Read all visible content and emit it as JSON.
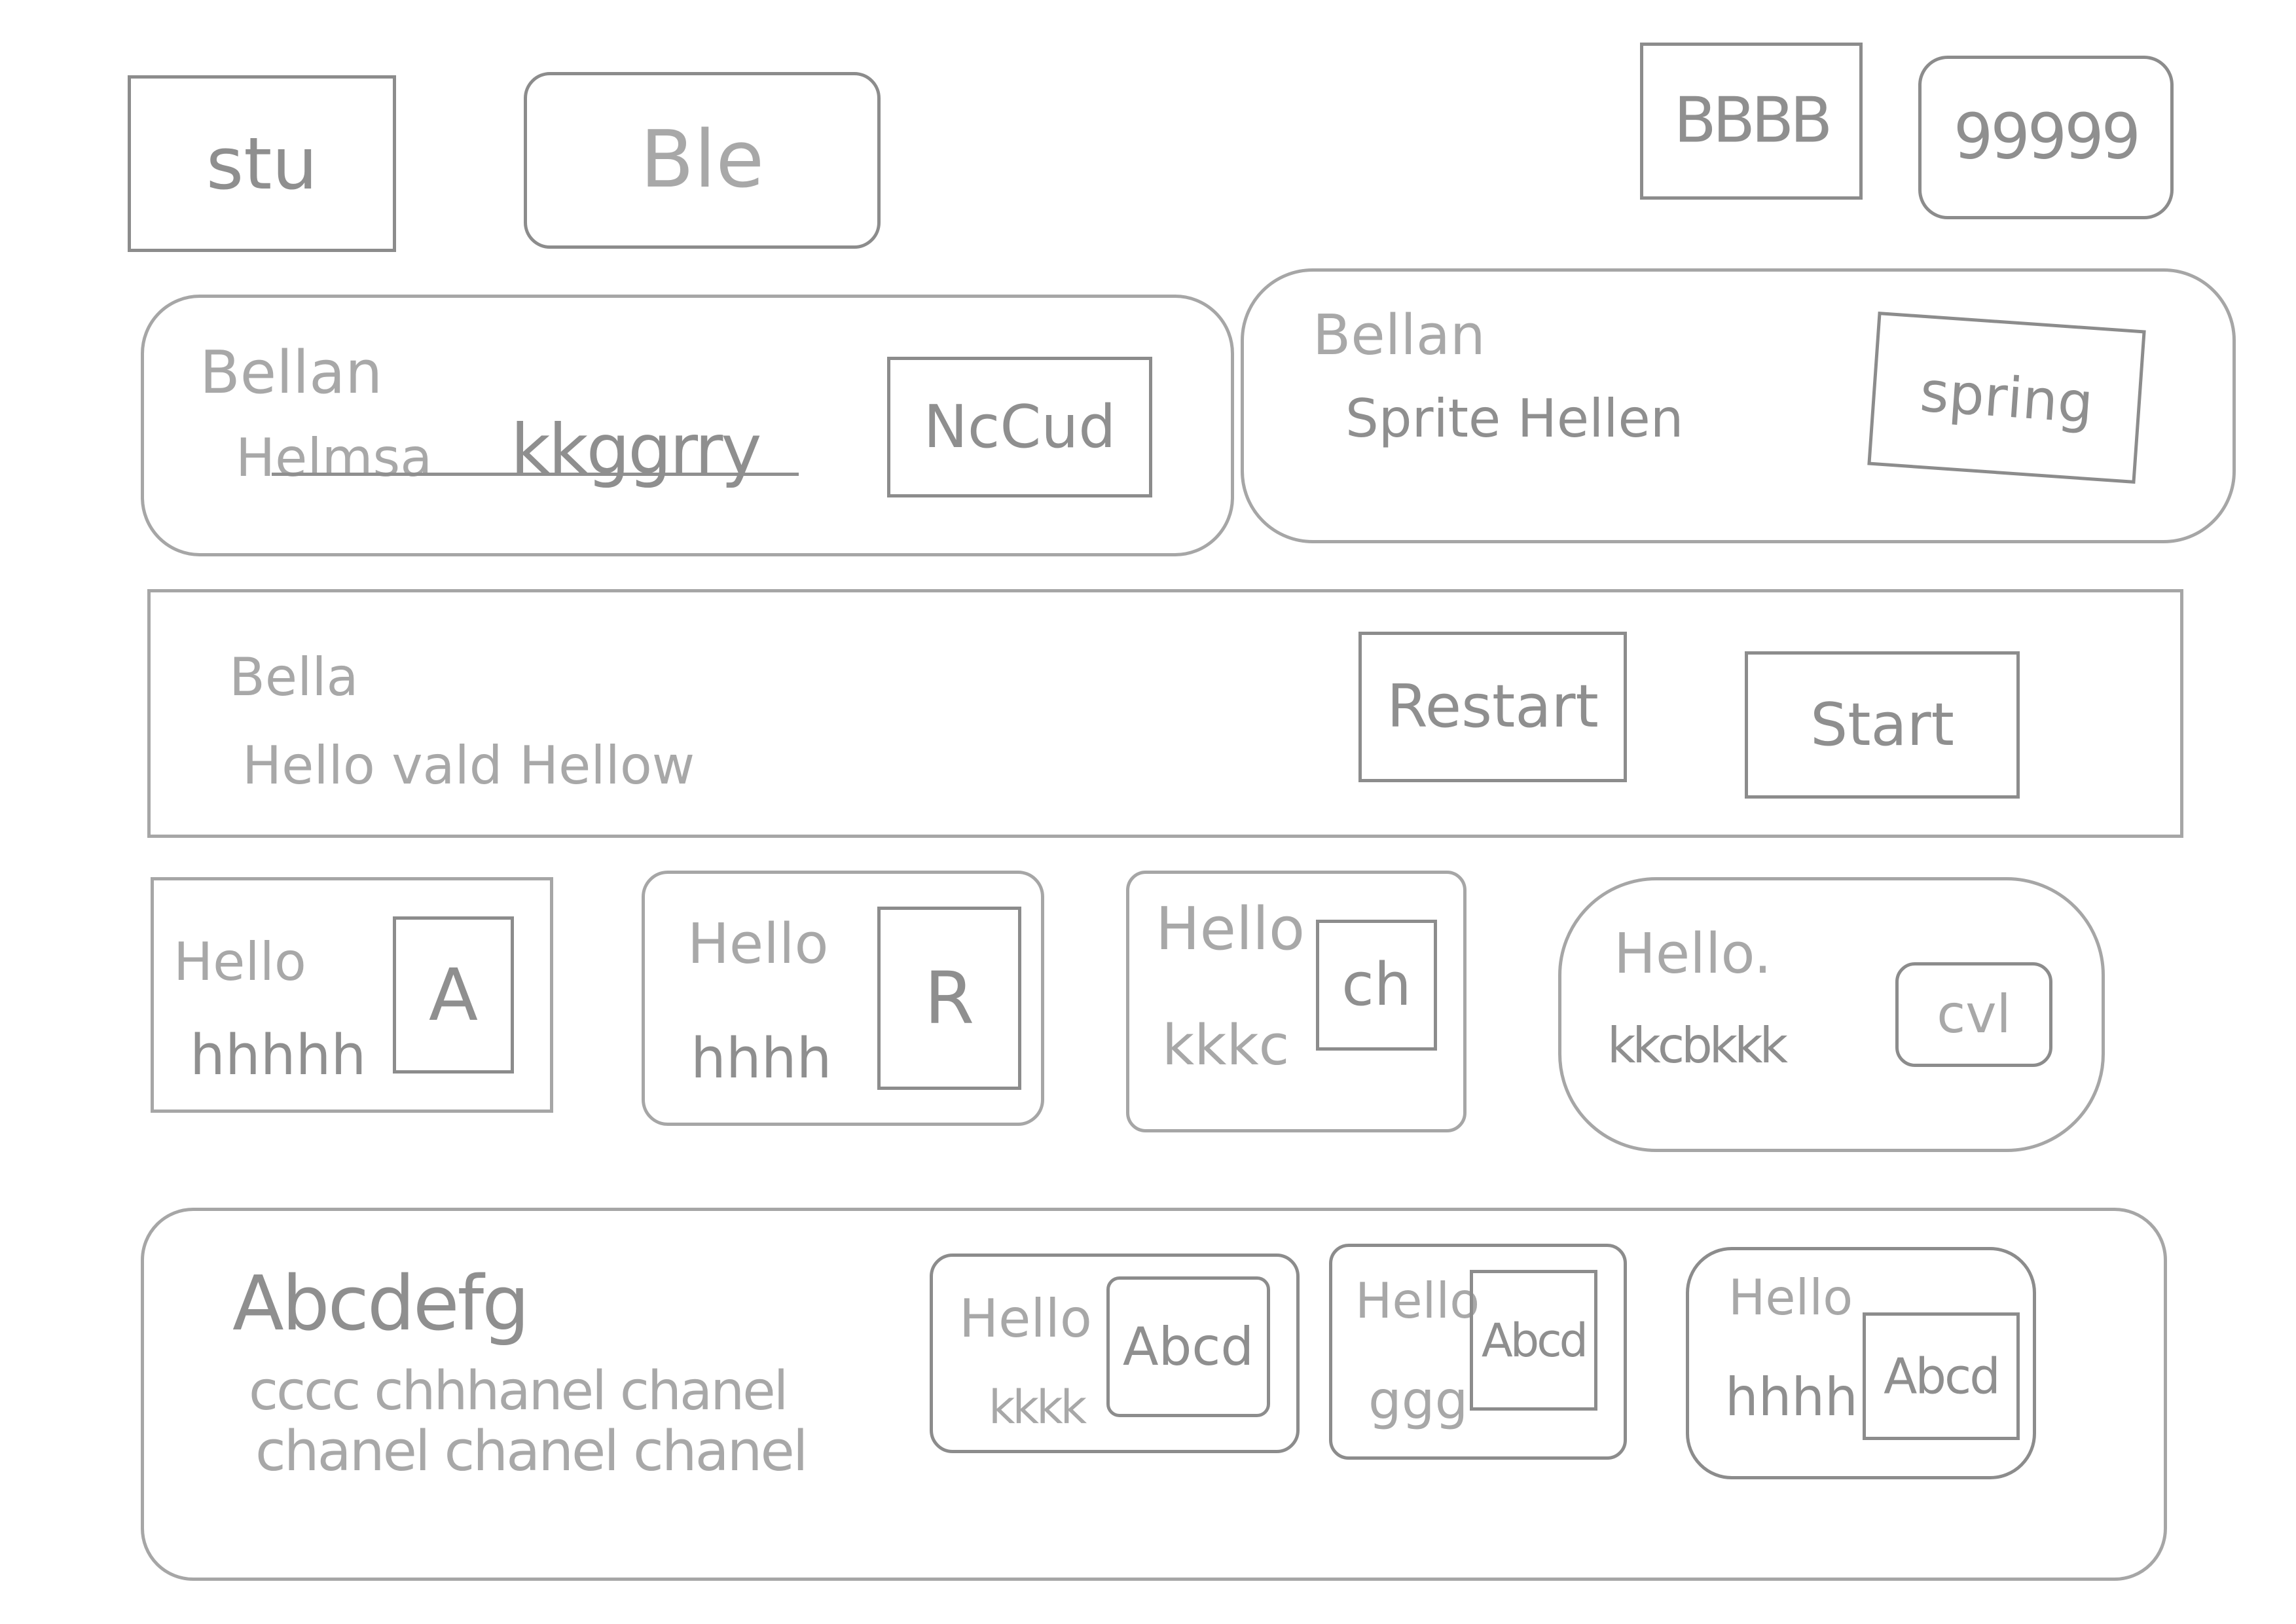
{
  "top_bar": {
    "btn1_label": "stu",
    "btn2_label": "Ble",
    "btn3_label": "BBBB",
    "btn4_label": "99999"
  },
  "card_a": {
    "title": "Bellan",
    "line1": "Helmsa",
    "line2": "kkggrry",
    "button_label": "NcCud"
  },
  "card_b": {
    "title": "Bellan",
    "line1": "Sprite Hellen",
    "button_label": "spring"
  },
  "banner": {
    "title": "Bella",
    "line1": "Hello vald Hellow",
    "restart_label": "Restart",
    "start_label": "Start"
  },
  "row_cards": [
    {
      "title": "Hello",
      "sub": "hhhhh",
      "button_label": "A"
    },
    {
      "title": "Hello",
      "sub": "hhhh",
      "button_label": "R"
    },
    {
      "title": "Hello",
      "sub": "kkkc",
      "button_label": "ch"
    },
    {
      "title": "Hello.",
      "sub": "kkcbkkk",
      "button_label": "cvl"
    }
  ],
  "footer_panel": {
    "heading": "Abcdefg",
    "line1": "cccc chhhanel chanel",
    "line2": "chanel chanel chanel",
    "mini_cards": [
      {
        "title": "Hello",
        "sub": "kkkk",
        "button_label": "Abcd"
      },
      {
        "title": "Hello",
        "sub": "ggg",
        "button_label": "Abcd"
      },
      {
        "title": "Hello",
        "sub": "hhhh",
        "button_label": "Abcd"
      }
    ]
  }
}
